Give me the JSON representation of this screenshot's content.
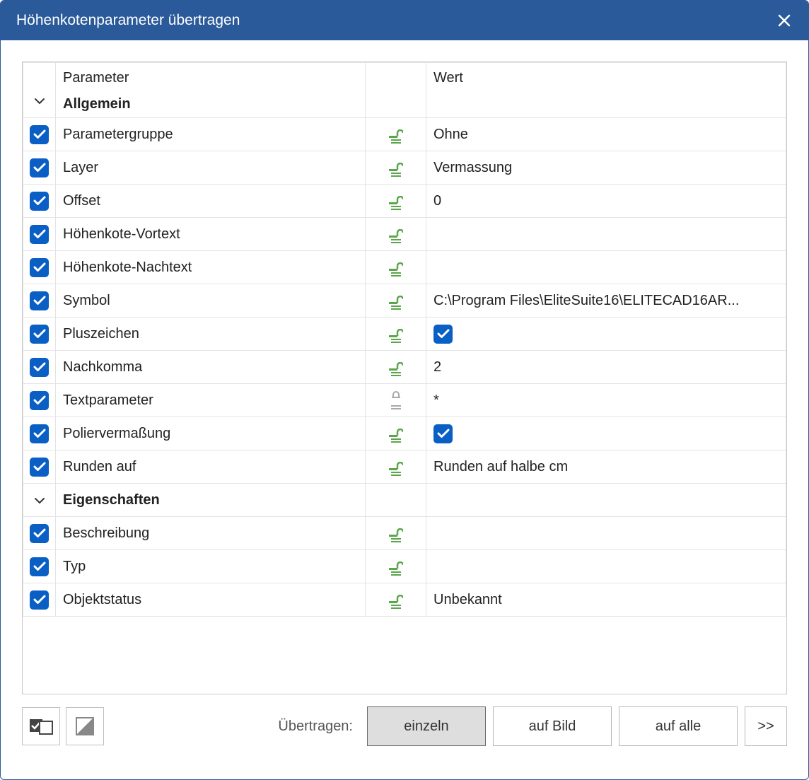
{
  "title": "Höhenkotenparameter übertragen",
  "table": {
    "headers": {
      "parameter": "Parameter",
      "value": "Wert"
    },
    "groups": [
      {
        "name": "Allgemein",
        "rows": [
          {
            "checked": true,
            "label": "Parametergruppe",
            "locked": false,
            "value": "Ohne"
          },
          {
            "checked": true,
            "label": "Layer",
            "locked": false,
            "value": "Vermassung"
          },
          {
            "checked": true,
            "label": "Offset",
            "locked": false,
            "value": "0"
          },
          {
            "checked": true,
            "label": "Höhenkote-Vortext",
            "locked": false,
            "value": ""
          },
          {
            "checked": true,
            "label": "Höhenkote-Nachtext",
            "locked": false,
            "value": ""
          },
          {
            "checked": true,
            "label": "Symbol",
            "locked": false,
            "value": "C:\\Program Files\\EliteSuite16\\ELITECAD16AR..."
          },
          {
            "checked": true,
            "label": "Pluszeichen",
            "locked": false,
            "valueType": "checkbox",
            "valueChecked": true
          },
          {
            "checked": true,
            "label": "Nachkomma",
            "locked": false,
            "value": "2"
          },
          {
            "checked": true,
            "label": "Textparameter",
            "locked": true,
            "value": "*"
          },
          {
            "checked": true,
            "label": "Poliervermaßung",
            "locked": false,
            "valueType": "checkbox",
            "valueChecked": true
          },
          {
            "checked": true,
            "label": "Runden auf",
            "locked": false,
            "value": "Runden auf halbe cm"
          }
        ]
      },
      {
        "name": "Eigenschaften",
        "rows": [
          {
            "checked": true,
            "label": "Beschreibung",
            "locked": false,
            "value": ""
          },
          {
            "checked": true,
            "label": "Typ",
            "locked": false,
            "value": ""
          },
          {
            "checked": true,
            "label": "Objektstatus",
            "locked": false,
            "value": "Unbekannt"
          }
        ]
      }
    ]
  },
  "footer": {
    "transferLabel": "Übertragen:",
    "buttons": {
      "single": "einzeln",
      "onImage": "auf Bild",
      "onAll": "auf alle",
      "expand": ">>"
    }
  }
}
